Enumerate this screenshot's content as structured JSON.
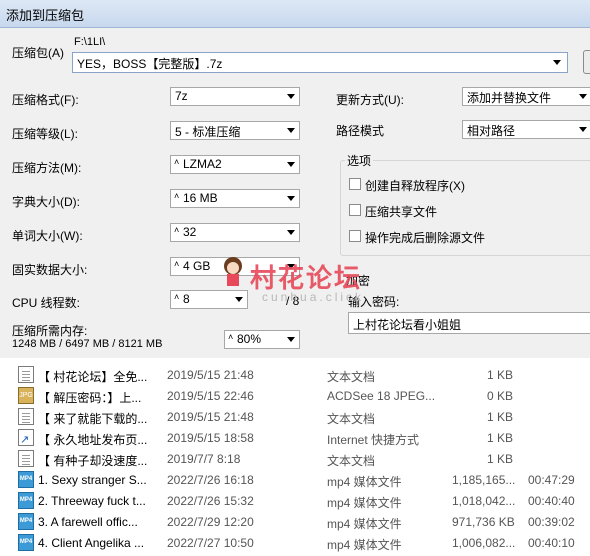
{
  "window": {
    "title": "添加到压缩包"
  },
  "archive": {
    "label": "压缩包(A)",
    "path": "F:\\1LI\\",
    "filename": "YES，BOSS【完整版】.7z"
  },
  "left_fields": [
    {
      "label": "压缩格式(F):",
      "value": "7z"
    },
    {
      "label": "压缩等级(L):",
      "value": "5 - 标准压缩"
    },
    {
      "label": "压缩方法(M):",
      "value": "LZMA2"
    },
    {
      "label": "字典大小(D):",
      "value": "16 MB"
    },
    {
      "label": "单词大小(W):",
      "value": "32"
    },
    {
      "label": "固实数据大小:",
      "value": "4 GB"
    },
    {
      "label": "CPU 线程数:",
      "value": "8",
      "suffix": "/ 8"
    }
  ],
  "memory": {
    "label": "压缩所需内存:",
    "values": "1248 MB / 6497 MB / 8121 MB",
    "percent": "80%"
  },
  "right_fields": [
    {
      "label": "更新方式(U):",
      "value": "添加并替换文件"
    },
    {
      "label": "路径模式",
      "value": "相对路径"
    }
  ],
  "options": {
    "title": "选项",
    "items": [
      {
        "label": "创建自释放程序(X)",
        "checked": false
      },
      {
        "label": "压缩共享文件",
        "checked": false
      },
      {
        "label": "操作完成后删除源文件",
        "checked": false
      }
    ]
  },
  "encryption": {
    "title": "加密",
    "password_label": "输入密码:",
    "password_value": "上村花论坛看小姐姐"
  },
  "watermark": {
    "text": "村花论坛",
    "sub": "cunhua.click"
  },
  "files": [
    {
      "icon": "text-file-icon",
      "name": "【 村花论坛】全免...",
      "date": "2019/5/15 21:48",
      "type": "文本文档",
      "size": "1 KB",
      "duration": ""
    },
    {
      "icon": "jpeg-file-icon",
      "name": "【 解压密码：】上...",
      "date": "2019/5/15 22:46",
      "type": "ACDSee 18 JPEG...",
      "size": "0 KB",
      "duration": ""
    },
    {
      "icon": "text-file-icon",
      "name": "【 来了就能下载的...",
      "date": "2019/5/15 21:48",
      "type": "文本文档",
      "size": "1 KB",
      "duration": ""
    },
    {
      "icon": "shortcut-file-icon",
      "name": "【 永久地址发布页...",
      "date": "2019/5/15 18:58",
      "type": "Internet 快捷方式",
      "size": "1 KB",
      "duration": ""
    },
    {
      "icon": "text-file-icon",
      "name": "【 有种子却没速度...",
      "date": "2019/7/7 8:18",
      "type": "文本文档",
      "size": "1 KB",
      "duration": ""
    },
    {
      "icon": "mp4-file-icon",
      "name": "1. Sexy stranger S...",
      "date": "2022/7/26 16:18",
      "type": "mp4 媒体文件",
      "size": "1,185,165...",
      "duration": "00:47:29"
    },
    {
      "icon": "mp4-file-icon",
      "name": "2. Threeway fuck t...",
      "date": "2022/7/26 15:32",
      "type": "mp4 媒体文件",
      "size": "1,018,042...",
      "duration": "00:40:40"
    },
    {
      "icon": "mp4-file-icon",
      "name": "3. A farewell offic...",
      "date": "2022/7/29 12:20",
      "type": "mp4 媒体文件",
      "size": "971,736 KB",
      "duration": "00:39:02"
    },
    {
      "icon": "mp4-file-icon",
      "name": "4. Client Angelika ...",
      "date": "2022/7/27 10:50",
      "type": "mp4 媒体文件",
      "size": "1,006,082...",
      "duration": "00:40:10"
    }
  ]
}
